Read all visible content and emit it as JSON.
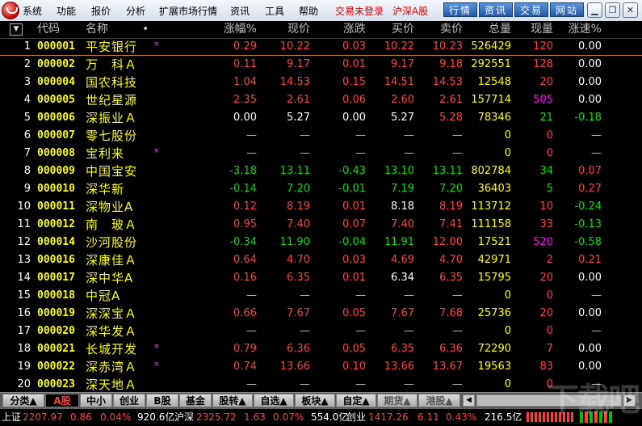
{
  "menubar": {
    "items": [
      "系统",
      "功能",
      "报价",
      "分析",
      "扩展市场行情",
      "资讯",
      "工具",
      "帮助"
    ],
    "trade_status": "交易未登录",
    "market": "沪深A股",
    "buttons": [
      "行情",
      "资讯",
      "交易",
      "网站"
    ],
    "window_controls": [
      "minimize-icon",
      "restore-icon",
      "close-icon"
    ]
  },
  "header": {
    "sort_icon": "▼",
    "columns": [
      "代码",
      "名称",
      "•",
      "涨幅%",
      "现价",
      "涨跌",
      "买价",
      "卖价",
      "总量",
      "现量",
      "涨速%"
    ]
  },
  "rows": [
    {
      "idx": "1",
      "code": "000001",
      "name": "平安银行",
      "mark": "×",
      "chg_pct": "0.29",
      "price": "10.22",
      "chg": "0.03",
      "bid": "10.22",
      "ask": "10.23",
      "vol": "526429",
      "cur_vol": "120",
      "speed": "0.00"
    },
    {
      "idx": "2",
      "code": "000002",
      "name": "万　科Ａ",
      "mark": "",
      "chg_pct": "0.11",
      "price": "9.17",
      "chg": "0.01",
      "bid": "9.17",
      "ask": "9.18",
      "vol": "292551",
      "cur_vol": "128",
      "speed": "0.00"
    },
    {
      "idx": "3",
      "code": "000004",
      "name": "国农科技",
      "mark": "",
      "chg_pct": "1.04",
      "price": "14.53",
      "chg": "0.15",
      "bid": "14.51",
      "ask": "14.53",
      "vol": "12548",
      "cur_vol": "20",
      "speed": "0.00"
    },
    {
      "idx": "4",
      "code": "000005",
      "name": "世纪星源",
      "mark": "",
      "chg_pct": "2.35",
      "price": "2.61",
      "chg": "0.06",
      "bid": "2.60",
      "ask": "2.61",
      "vol": "157714",
      "cur_vol": "505",
      "speed": "0.00"
    },
    {
      "idx": "5",
      "code": "000006",
      "name": "深振业Ａ",
      "mark": "",
      "chg_pct": "0.00",
      "price": "5.27",
      "chg": "0.00",
      "bid": "5.27",
      "ask": "5.28",
      "vol": "78346",
      "cur_vol": "21",
      "speed": "-0.18"
    },
    {
      "idx": "6",
      "code": "000007",
      "name": "零七股份",
      "mark": "",
      "chg_pct": "—",
      "price": "—",
      "chg": "—",
      "bid": "—",
      "ask": "—",
      "vol": "0",
      "cur_vol": "0",
      "speed": "—"
    },
    {
      "idx": "7",
      "code": "000008",
      "name": "宝利来",
      "mark": "×",
      "chg_pct": "—",
      "price": "—",
      "chg": "—",
      "bid": "—",
      "ask": "—",
      "vol": "0",
      "cur_vol": "0",
      "speed": "—"
    },
    {
      "idx": "8",
      "code": "000009",
      "name": "中国宝安",
      "mark": "",
      "chg_pct": "-3.18",
      "price": "13.11",
      "chg": "-0.43",
      "bid": "13.10",
      "ask": "13.11",
      "vol": "802784",
      "cur_vol": "34",
      "speed": "0.07"
    },
    {
      "idx": "9",
      "code": "000010",
      "name": "深华新",
      "mark": "",
      "chg_pct": "-0.14",
      "price": "7.20",
      "chg": "-0.01",
      "bid": "7.19",
      "ask": "7.20",
      "vol": "36403",
      "cur_vol": "5",
      "speed": "0.27"
    },
    {
      "idx": "10",
      "code": "000011",
      "name": "深物业A",
      "mark": "",
      "chg_pct": "0.12",
      "price": "8.19",
      "chg": "0.01",
      "bid": "8.18",
      "ask": "8.19",
      "vol": "113712",
      "cur_vol": "10",
      "speed": "-0.24"
    },
    {
      "idx": "11",
      "code": "000012",
      "name": "南　玻Ａ",
      "mark": "",
      "chg_pct": "0.95",
      "price": "7.40",
      "chg": "0.07",
      "bid": "7.40",
      "ask": "7.41",
      "vol": "111158",
      "cur_vol": "33",
      "speed": "-0.13"
    },
    {
      "idx": "12",
      "code": "000014",
      "name": "沙河股份",
      "mark": "",
      "chg_pct": "-0.34",
      "price": "11.90",
      "chg": "-0.04",
      "bid": "11.91",
      "ask": "12.00",
      "vol": "17521",
      "cur_vol": "520",
      "speed": "-0.58"
    },
    {
      "idx": "13",
      "code": "000016",
      "name": "深康佳Ａ",
      "mark": "",
      "chg_pct": "0.64",
      "price": "4.70",
      "chg": "0.03",
      "bid": "4.69",
      "ask": "4.70",
      "vol": "42971",
      "cur_vol": "2",
      "speed": "0.21"
    },
    {
      "idx": "14",
      "code": "000017",
      "name": "深中华A",
      "mark": "",
      "chg_pct": "0.16",
      "price": "6.35",
      "chg": "0.01",
      "bid": "6.34",
      "ask": "6.35",
      "vol": "15795",
      "cur_vol": "20",
      "speed": "0.00"
    },
    {
      "idx": "15",
      "code": "000018",
      "name": "中冠A",
      "mark": "",
      "chg_pct": "—",
      "price": "—",
      "chg": "—",
      "bid": "—",
      "ask": "—",
      "vol": "0",
      "cur_vol": "0",
      "speed": "—"
    },
    {
      "idx": "16",
      "code": "000019",
      "name": "深深宝Ａ",
      "mark": "",
      "chg_pct": "0.66",
      "price": "7.67",
      "chg": "0.05",
      "bid": "7.67",
      "ask": "7.68",
      "vol": "25736",
      "cur_vol": "20",
      "speed": "0.00"
    },
    {
      "idx": "17",
      "code": "000020",
      "name": "深华发Ａ",
      "mark": "",
      "chg_pct": "—",
      "price": "—",
      "chg": "—",
      "bid": "—",
      "ask": "—",
      "vol": "0",
      "cur_vol": "0",
      "speed": "—"
    },
    {
      "idx": "18",
      "code": "000021",
      "name": "长城开发",
      "mark": "×",
      "chg_pct": "0.79",
      "price": "6.36",
      "chg": "0.05",
      "bid": "6.35",
      "ask": "6.36",
      "vol": "72290",
      "cur_vol": "7",
      "speed": "0.00"
    },
    {
      "idx": "19",
      "code": "000022",
      "name": "深赤湾Ａ",
      "mark": "×",
      "chg_pct": "0.74",
      "price": "13.66",
      "chg": "0.10",
      "bid": "13.66",
      "ask": "13.67",
      "vol": "19563",
      "cur_vol": "83",
      "speed": "0.00"
    },
    {
      "idx": "20",
      "code": "000023",
      "name": "深天地Ａ",
      "mark": "",
      "chg_pct": "—",
      "price": "—",
      "chg": "—",
      "bid": "—",
      "ask": "—",
      "vol": "0",
      "cur_vol": "0",
      "speed": "—"
    }
  ],
  "tabs": [
    "分类▲",
    "A股",
    "中小",
    "创业",
    "B股",
    "基金",
    "股转▲",
    "自选▲",
    "板块▲",
    "自定▲",
    "期货▲",
    "港股▲"
  ],
  "status": {
    "sh_label": "上证",
    "sh_index": "2207.97",
    "sh_chg": "0.86",
    "sh_pct": "0.04%",
    "sh_amt": "920.6亿",
    "sz_label": "沪深",
    "sz_index": "2325.72",
    "sz_chg": "1.63",
    "sz_pct": "0.07%",
    "sz_amt": "554.0亿",
    "cy_label": "创业",
    "cy_index": "1417.26",
    "cy_chg": "6.11",
    "cy_pct": "0.43%",
    "cy_amt": "216.5亿"
  },
  "watermark": "下载吧"
}
